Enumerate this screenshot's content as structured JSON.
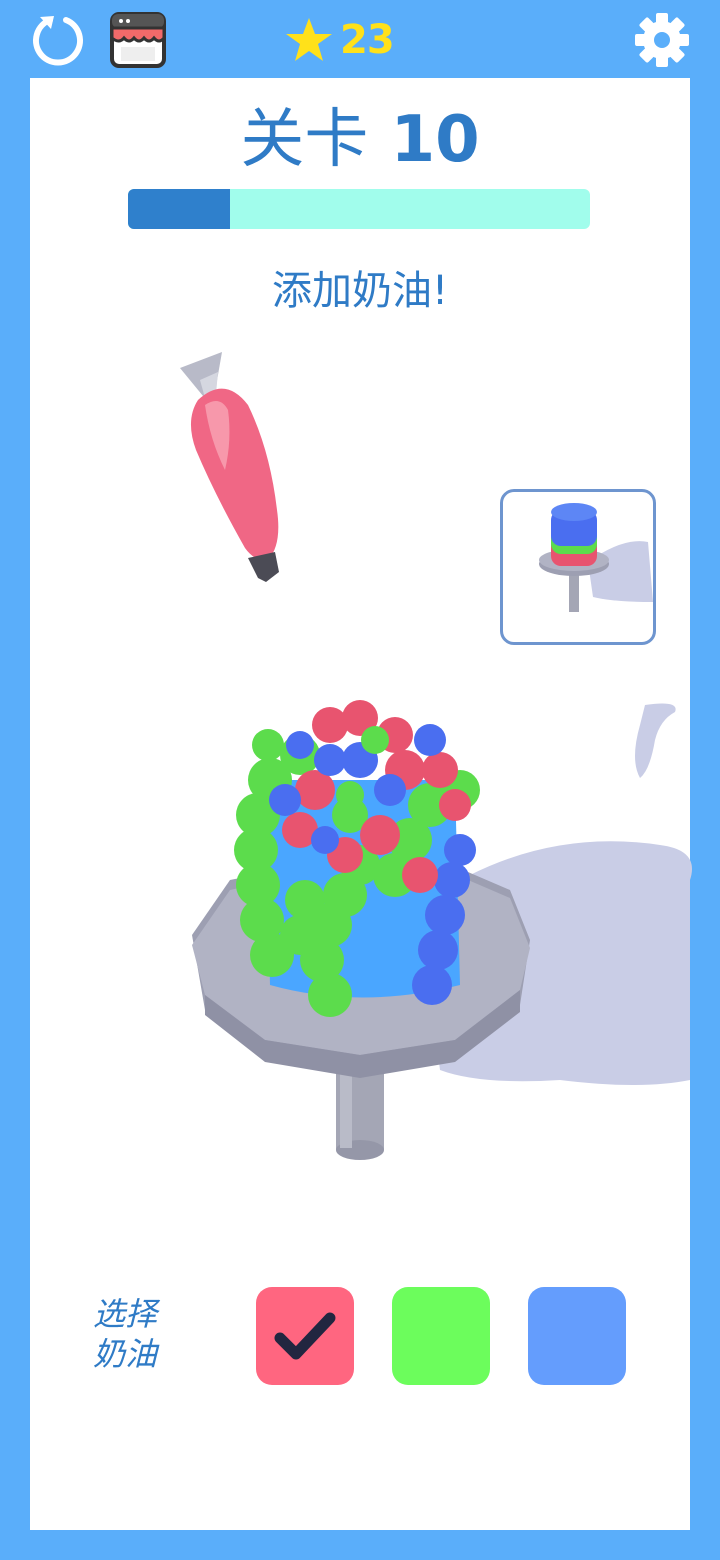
{
  "header": {
    "stars_count": "23",
    "icons": [
      "restart-icon",
      "shop-icon",
      "star-icon",
      "gear-icon"
    ]
  },
  "level": {
    "label": "关卡",
    "number": "10",
    "progress": 0.22
  },
  "hint": "添加奶油!",
  "cream_selector": {
    "label": "选择奶油",
    "label_line1": "选择",
    "label_line2": "奶油",
    "options": [
      {
        "color": "#ff6680",
        "selected": true
      },
      {
        "color": "#6cfd5c",
        "selected": false
      },
      {
        "color": "#649dfd",
        "selected": false
      }
    ]
  },
  "colors": {
    "background": "#5aaefa",
    "accent_text": "#2f7bc6",
    "star": "#ffe11a",
    "progress_fill": "#2f80cc",
    "progress_track": "#a1fdec"
  }
}
